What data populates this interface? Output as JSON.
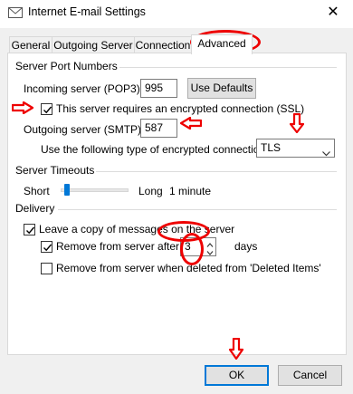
{
  "window": {
    "title": "Internet E-mail Settings",
    "close_glyph": "✕",
    "icon": "envelope-icon"
  },
  "tabs": [
    {
      "label": "General",
      "active": false
    },
    {
      "label": "Outgoing Server",
      "active": false
    },
    {
      "label": "Connection",
      "active": false
    },
    {
      "label": "Advanced",
      "active": true
    }
  ],
  "server_ports": {
    "group_label": "Server Port Numbers",
    "incoming_label": "Incoming server (POP3):",
    "incoming_value": "995",
    "use_defaults_label": "Use Defaults",
    "ssl_label": "This server requires an encrypted connection (SSL)",
    "ssl_checked": true,
    "outgoing_label": "Outgoing server (SMTP):",
    "outgoing_value": "587",
    "encryption_label": "Use the following type of encrypted connection:",
    "encryption_value": "TLS"
  },
  "timeouts": {
    "group_label": "Server Timeouts",
    "short_label": "Short",
    "long_label": "Long",
    "value_label": "1 minute",
    "slider_level": 0.1
  },
  "delivery": {
    "group_label": "Delivery",
    "leave_copy_label": "Leave a copy of messages on the server",
    "leave_copy_checked": true,
    "remove_after_label": "Remove from server after",
    "remove_after_checked": true,
    "days_value": "3",
    "days_label": "days",
    "remove_deleted_label": "Remove from server when deleted from 'Deleted Items'",
    "remove_deleted_checked": false
  },
  "footer": {
    "ok_label": "OK",
    "cancel_label": "Cancel"
  },
  "annotation_color": "#e00000"
}
